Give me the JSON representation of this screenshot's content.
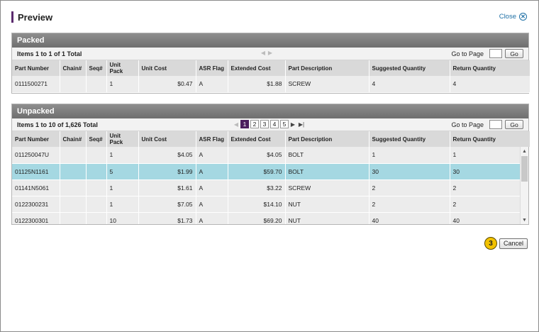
{
  "title": "Preview",
  "close_label": "Close",
  "packed": {
    "heading": "Packed",
    "items_text": "Items 1 to 1 of 1 Total",
    "goto_label": "Go to Page",
    "go_label": "Go",
    "columns": [
      "Part Number",
      "Chain#",
      "Seq#",
      "Unit Pack",
      "Unit Cost",
      "ASR Flag",
      "Extended Cost",
      "Part Description",
      "Suggested Quantity",
      "Return Quantity"
    ],
    "rows": [
      [
        "0111500271",
        "",
        "",
        "1",
        "$0.47",
        "A",
        "$1.88",
        "SCREW",
        "4",
        "4"
      ]
    ]
  },
  "unpacked": {
    "heading": "Unpacked",
    "items_text": "Items 1 to 10 of 1,626 Total",
    "goto_label": "Go to Page",
    "go_label": "Go",
    "pages": [
      "1",
      "2",
      "3",
      "4",
      "5"
    ],
    "current_page": "1",
    "columns": [
      "Part Number",
      "Chain#",
      "Seq#",
      "Unit Pack",
      "Unit Cost",
      "ASR Flag",
      "Extended Cost",
      "Part Description",
      "Suggested Quantity",
      "Return Quantity"
    ],
    "rows": [
      [
        "011250047U",
        "",
        "",
        "1",
        "$4.05",
        "A",
        "$4.05",
        "BOLT",
        "1",
        "1"
      ],
      [
        "01125N1161",
        "",
        "",
        "5",
        "$1.99",
        "A",
        "$59.70",
        "BOLT",
        "30",
        "30"
      ],
      [
        "01141N5061",
        "",
        "",
        "1",
        "$1.61",
        "A",
        "$3.22",
        "SCREW",
        "2",
        "2"
      ],
      [
        "0122300231",
        "",
        "",
        "1",
        "$7.05",
        "A",
        "$14.10",
        "NUT",
        "2",
        "2"
      ],
      [
        "0122300301",
        "",
        "",
        "10",
        "$1.73",
        "A",
        "$69.20",
        "NUT",
        "40",
        "40"
      ]
    ],
    "selected_row": 1
  },
  "callout_number": "3",
  "cancel_label": "Cancel",
  "colors": {
    "accent": "#5b2a6e",
    "link": "#1d6fa5",
    "panel_header": "#7a7a7a",
    "selected_row": "#a5d8e2",
    "badge": "#f2c200"
  }
}
